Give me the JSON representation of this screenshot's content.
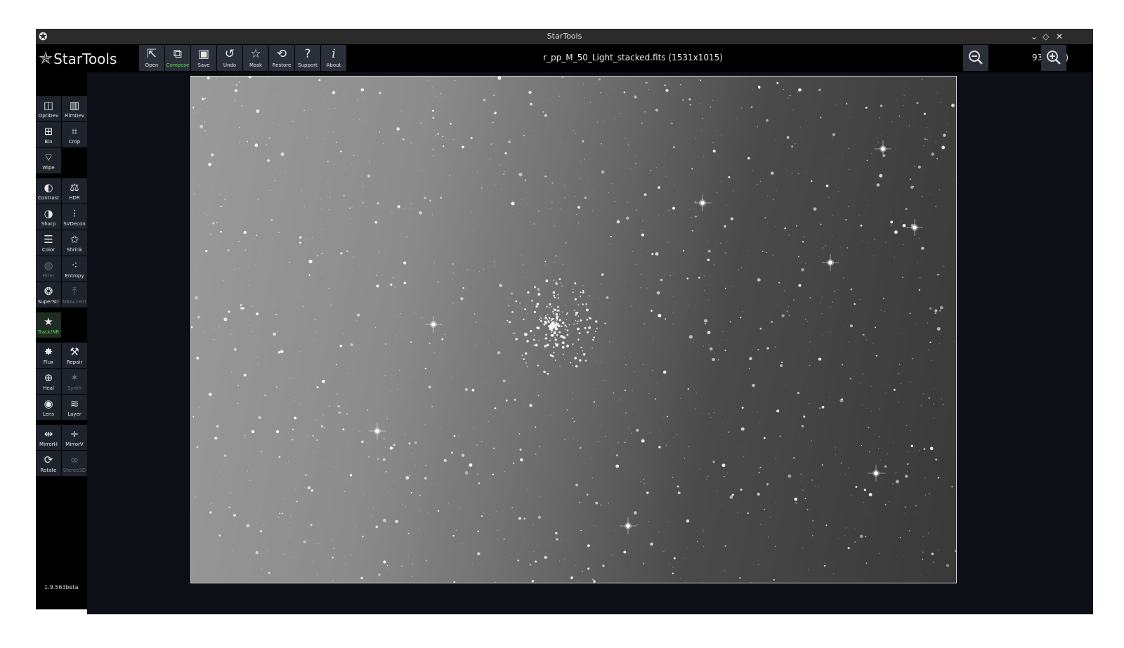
{
  "window": {
    "title": "StarTools"
  },
  "window_controls": {
    "minimize": "⌄",
    "restore": "◇",
    "close": "✕"
  },
  "logo": {
    "text": "StarTools"
  },
  "toolbar": {
    "buttons": [
      {
        "label": "Open",
        "icon": "open-icon"
      },
      {
        "label": "Compose",
        "icon": "compose-icon",
        "active": true
      },
      {
        "label": "Save",
        "icon": "save-icon"
      },
      {
        "label": "Undo",
        "icon": "undo-icon"
      },
      {
        "label": "Mask",
        "icon": "mask-icon"
      },
      {
        "label": "Restore",
        "icon": "restore-icon"
      },
      {
        "label": "Support",
        "icon": "support-icon"
      },
      {
        "label": "About",
        "icon": "about-icon"
      }
    ]
  },
  "document": {
    "filename": "r_pp_M_50_Light_stacked.fits (1531x1015)"
  },
  "zoom": {
    "level": "93% (fit)"
  },
  "tools": [
    {
      "label": "OptiDev",
      "icon": "optidev-icon"
    },
    {
      "label": "FilmDev",
      "icon": "filmdev-icon"
    },
    {
      "label": "Bin",
      "icon": "bin-icon"
    },
    {
      "label": "Crop",
      "icon": "crop-icon"
    },
    {
      "label": "Wipe",
      "icon": "wipe-icon"
    },
    {
      "label": "Contrast",
      "icon": "contrast-icon"
    },
    {
      "label": "HDR",
      "icon": "hdr-icon"
    },
    {
      "label": "Sharp",
      "icon": "sharp-icon"
    },
    {
      "label": "SVDecon",
      "icon": "svdecon-icon"
    },
    {
      "label": "Color",
      "icon": "color-icon"
    },
    {
      "label": "Shrink",
      "icon": "shrink-icon"
    },
    {
      "label": "Filter",
      "icon": "filter-icon",
      "disabled": true
    },
    {
      "label": "Entropy",
      "icon": "entropy-icon"
    },
    {
      "label": "SuperStr",
      "icon": "superstr-icon"
    },
    {
      "label": "NBAccent",
      "icon": "nbaccent-icon",
      "disabled": true
    },
    {
      "label": "Track/NR",
      "icon": "track-nr-icon",
      "active": true
    },
    {
      "label": "Flux",
      "icon": "flux-icon"
    },
    {
      "label": "Repair",
      "icon": "repair-icon"
    },
    {
      "label": "Heal",
      "icon": "heal-icon"
    },
    {
      "label": "Synth",
      "icon": "synth-icon",
      "disabled": true
    },
    {
      "label": "Lens",
      "icon": "lens-icon"
    },
    {
      "label": "Layer",
      "icon": "layer-icon"
    },
    {
      "label": "MirrorH",
      "icon": "mirrorh-icon"
    },
    {
      "label": "MirrorV",
      "icon": "mirrorv-icon"
    },
    {
      "label": "Rotate",
      "icon": "rotate-icon"
    },
    {
      "label": "Stereo3D",
      "icon": "stereo3d-icon",
      "disabled": true
    }
  ],
  "version": "1.9.563beta",
  "colors": {
    "accent_active": "#5ee04a",
    "button_bg": "#2a2f3a",
    "canvas_bg": "#0d0f16"
  }
}
